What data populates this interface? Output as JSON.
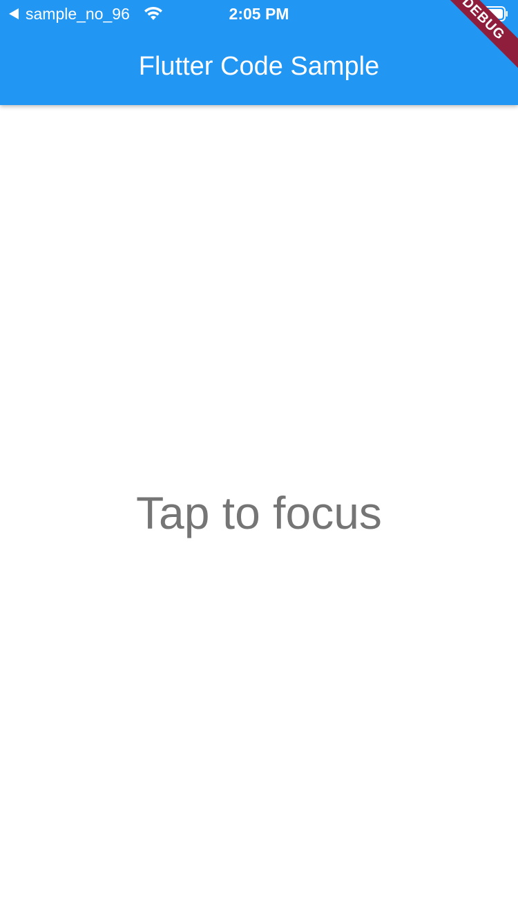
{
  "status_bar": {
    "back_app_label": "sample_no_96",
    "time": "2:05 PM",
    "icons": [
      "back-triangle-icon",
      "wifi-icon",
      "battery-icon"
    ]
  },
  "appbar": {
    "title": "Flutter Code Sample",
    "color": "#2196F3"
  },
  "debug_banner": {
    "label": "DEBUG",
    "color": "#8E1E3B"
  },
  "body": {
    "message": "Tap to focus",
    "text_color": "#757575"
  }
}
